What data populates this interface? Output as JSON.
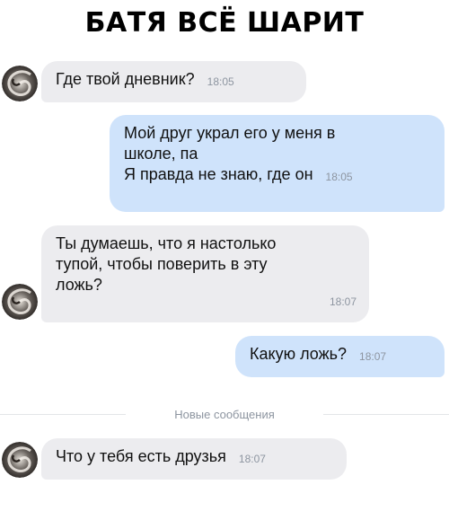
{
  "title": "БАТЯ ВСЁ ШАРИТ",
  "messages": [
    {
      "lines": [
        "Где твой дневник?"
      ],
      "time": "18:05",
      "direction": "incoming"
    },
    {
      "lines": [
        "Мой друг украл его у меня в",
        "школе, па",
        "Я правда не знаю, где он"
      ],
      "time": "18:05",
      "direction": "outgoing"
    },
    {
      "lines": [
        "Ты думаешь, что я настолько",
        "тупой, чтобы поверить в эту",
        "ложь?"
      ],
      "time": "18:07",
      "direction": "incoming"
    },
    {
      "lines": [
        "Какую ложь?"
      ],
      "time": "18:07",
      "direction": "outgoing"
    },
    {
      "lines": [
        "Что у тебя есть друзья"
      ],
      "time": "18:07",
      "direction": "incoming"
    }
  ],
  "divider_label": "Новые сообщения",
  "colors": {
    "incoming_bubble": "#ececef",
    "outgoing_bubble": "#cfe3fb",
    "timestamp": "#8d95a0"
  },
  "icons": {
    "avatar": "swirl-avatar-icon"
  }
}
